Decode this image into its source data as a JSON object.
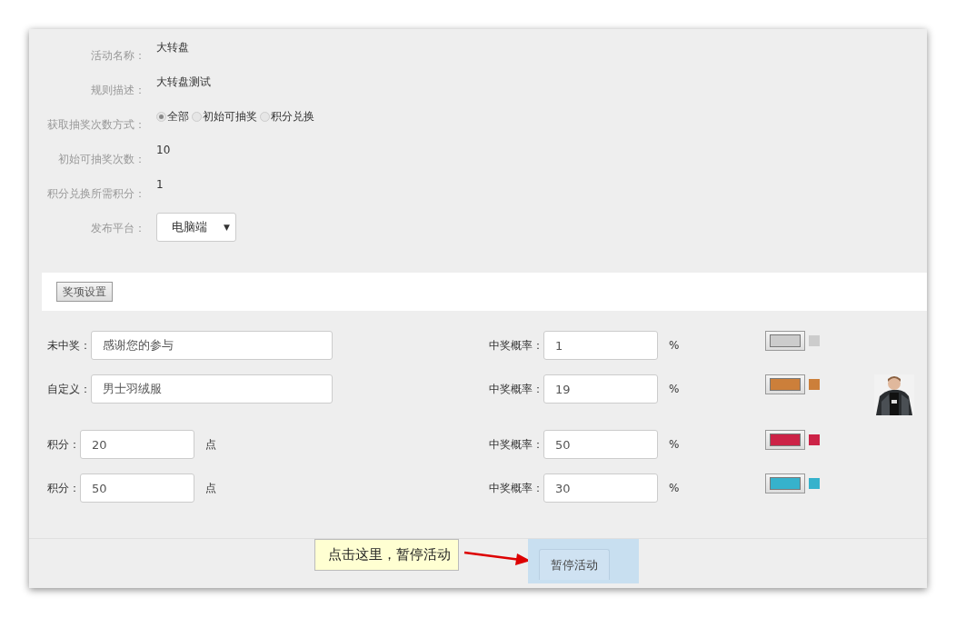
{
  "info": [
    {
      "label": "活动名称：",
      "value": "大转盘"
    },
    {
      "label": "规则描述：",
      "value": "大转盘测试"
    },
    {
      "label": "获取抽奖次数方式：",
      "kind": "radio",
      "options": [
        {
          "label": "全部",
          "selected": true
        },
        {
          "label": "初始可抽奖",
          "selected": false
        },
        {
          "label": "积分兑换",
          "selected": false
        }
      ]
    },
    {
      "label": "初始可抽奖次数：",
      "value": "10"
    },
    {
      "label": "积分兑换所需积分：",
      "value": "1"
    },
    {
      "label": "发布平台：",
      "kind": "select",
      "value": "电脑端",
      "caret": "▼"
    }
  ],
  "prize_settings_button": "奖项设置",
  "prizes": [
    {
      "kind": "text",
      "label": "未中奖：",
      "value": "感谢您的参与",
      "prob_label": "中奖概率：",
      "prob": "1",
      "percent": "%",
      "color": "#cccccc"
    },
    {
      "kind": "text",
      "label": "自定义：",
      "value": "男士羽绒服",
      "prob_label": "中奖概率：",
      "prob": "19",
      "percent": "%",
      "color": "#cc7f3a"
    },
    {
      "kind": "points",
      "label": "积分：",
      "value": "20",
      "unit": "点",
      "prob_label": "中奖概率：",
      "prob": "50",
      "percent": "%",
      "color": "#cc2347"
    },
    {
      "kind": "points",
      "label": "积分：",
      "value": "50",
      "unit": "点",
      "prob_label": "中奖概率：",
      "prob": "30",
      "percent": "%",
      "color": "#36b2cc"
    }
  ],
  "footer": {
    "tip": "点击这里，暂停活动",
    "pause_button": "暂停活动"
  }
}
